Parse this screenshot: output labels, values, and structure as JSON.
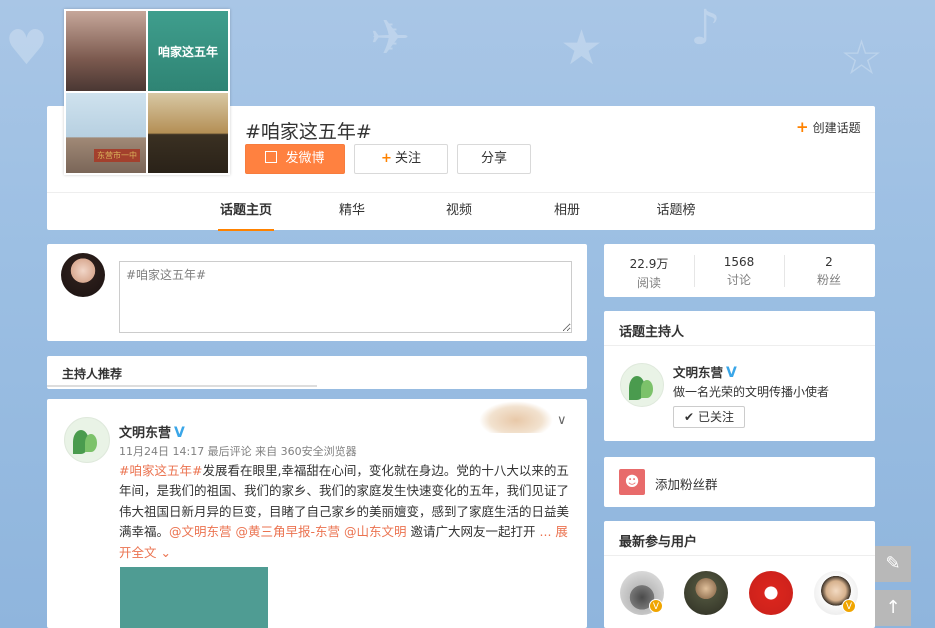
{
  "topic": {
    "title": "#咱家这五年#",
    "cover_caption": "咱家这五年",
    "cover_sign": "东营市一中"
  },
  "actions": {
    "post_label": "发微博",
    "follow_label": "关注",
    "share_label": "分享",
    "create_topic_label": "创建话题"
  },
  "nav": {
    "items": [
      {
        "label": "话题主页",
        "active": true
      },
      {
        "label": "精华",
        "active": false
      },
      {
        "label": "视频",
        "active": false
      },
      {
        "label": "相册",
        "active": false
      },
      {
        "label": "话题榜",
        "active": false
      }
    ]
  },
  "publisher": {
    "placeholder": "#咱家这五年#"
  },
  "host_recommend": {
    "label": "主持人推荐"
  },
  "feed": {
    "author": "文明东营",
    "meta": "11月24日 14:17 最后评论 来自 360安全浏览器",
    "tag": "#咱家这五年#",
    "body_1": "发展看在眼里,幸福甜在心间，变化就在身边。党的十八大以来的五年间，是我们的祖国、我们的家乡、我们的家庭发生快速变化的五年，我们见证了伟大祖国日新月异的巨变，目睹了自己家乡的美丽嬗变，感到了家庭生活的日益美满幸福。",
    "mention_1": "@文明东营",
    "mention_2": "@黄三角早报-东营",
    "mention_3": "@山东文明",
    "body_2": " 邀请广大网友一起打开",
    "more": "... 展开全文"
  },
  "stats": [
    {
      "num": "22.9万",
      "label": "阅读"
    },
    {
      "num": "1568",
      "label": "讨论"
    },
    {
      "num": "2",
      "label": "粉丝"
    }
  ],
  "host": {
    "title": "话题主持人",
    "name": "文明东营",
    "desc": "做一名光荣的文明传播小使者",
    "followed_label": "已关注"
  },
  "fans": {
    "label": "添加粉丝群"
  },
  "participants": {
    "title": "最新参与用户"
  },
  "colors": {
    "accent": "#ff8200",
    "primary_button": "#ff8140",
    "link": "#eb7350",
    "verified": "#3aa6e8"
  }
}
